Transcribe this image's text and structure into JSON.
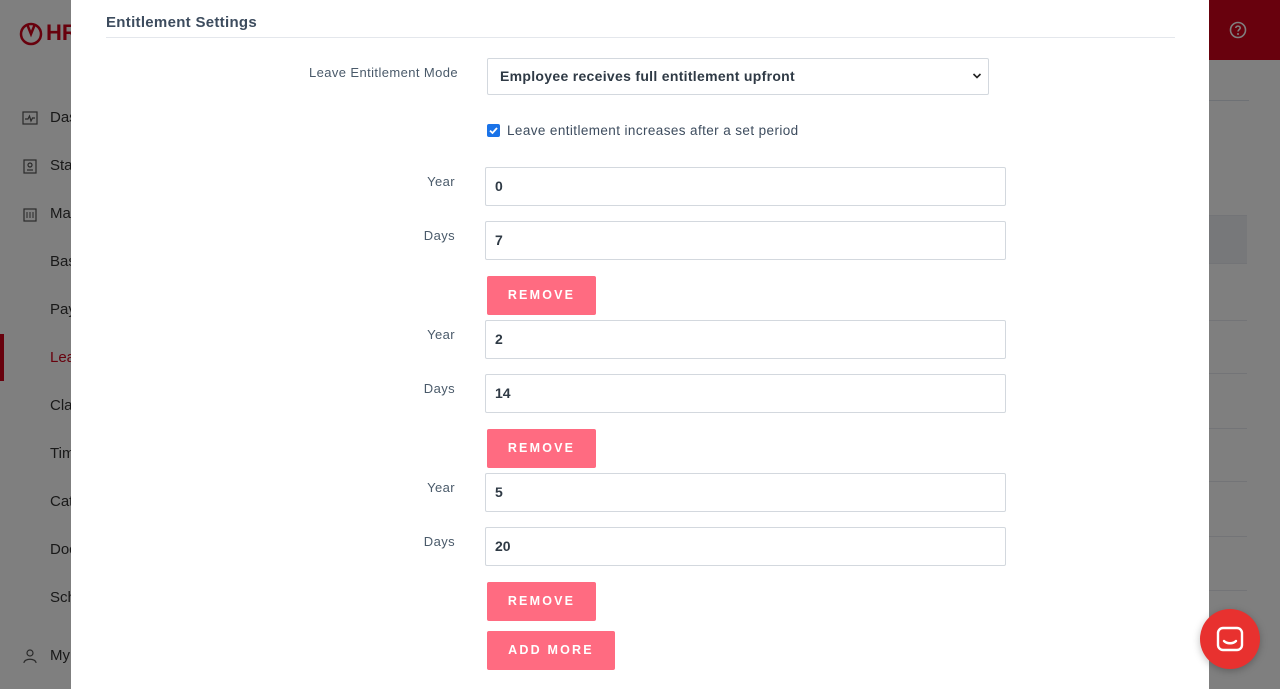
{
  "background_app": {
    "brand": "HR",
    "sidebar_items": [
      {
        "label": "Dashboard",
        "icon": "activity-icon"
      },
      {
        "label": "Staff",
        "icon": "badge-icon"
      },
      {
        "label": "Manage",
        "icon": "building-icon"
      },
      {
        "label": "Basic",
        "icon": ""
      },
      {
        "label": "Payroll",
        "icon": ""
      },
      {
        "label": "Leave",
        "icon": ""
      },
      {
        "label": "Claims",
        "icon": ""
      },
      {
        "label": "Time",
        "icon": ""
      },
      {
        "label": "Categories",
        "icon": ""
      },
      {
        "label": "Documents",
        "icon": ""
      },
      {
        "label": "Schedules",
        "icon": ""
      },
      {
        "label": "My",
        "icon": "user-icon"
      }
    ],
    "active_item": "Leave",
    "accent": "#d0021b"
  },
  "modal": {
    "section_title": "Entitlement Settings",
    "mode": {
      "label": "Leave Entitlement Mode",
      "selected": "Employee receives full entitlement upfront"
    },
    "increase_checkbox": {
      "checked": true,
      "label": "Leave entitlement increases after a set period"
    },
    "tiers": [
      {
        "year_label": "Year",
        "year": "0",
        "days_label": "Days",
        "days": "7",
        "remove_label": "REMOVE"
      },
      {
        "year_label": "Year",
        "year": "2",
        "days_label": "Days",
        "days": "14",
        "remove_label": "REMOVE"
      },
      {
        "year_label": "Year",
        "year": "5",
        "days_label": "Days",
        "days": "20",
        "remove_label": "REMOVE"
      }
    ],
    "add_more_label": "ADD MORE",
    "button_color": "#ff6b81"
  },
  "chat": {
    "icon": "chat-icon",
    "color": "#e8312f"
  }
}
